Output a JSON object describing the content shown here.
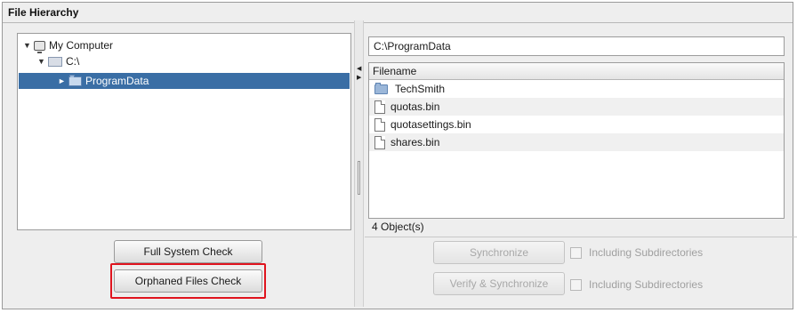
{
  "panel": {
    "title": "File Hierarchy"
  },
  "tree": {
    "root": {
      "label": "My Computer",
      "icon": "computer-icon",
      "expanded": true
    },
    "drive": {
      "label": "C:\\",
      "icon": "drive-icon",
      "expanded": true
    },
    "folder": {
      "label": "ProgramData",
      "icon": "folder-icon",
      "selected": true
    }
  },
  "left_buttons": {
    "full_check": "Full System Check",
    "orphaned_check": "Orphaned Files Check"
  },
  "right": {
    "path": "C:\\ProgramData",
    "column_header": "Filename",
    "files": [
      {
        "name": "TechSmith",
        "icon": "folder-icon"
      },
      {
        "name": "quotas.bin",
        "icon": "file-icon"
      },
      {
        "name": "quotasettings.bin",
        "icon": "file-icon"
      },
      {
        "name": "shares.bin",
        "icon": "file-icon"
      }
    ],
    "status": "4 Object(s)",
    "synchronize": "Synchronize",
    "verify_synchronize": "Verify & Synchronize",
    "including_sub_1": "Including Subdirectories",
    "including_sub_2": "Including Subdirectories"
  },
  "colors": {
    "selection": "#3a6ea5",
    "highlight": "#e0141e"
  }
}
